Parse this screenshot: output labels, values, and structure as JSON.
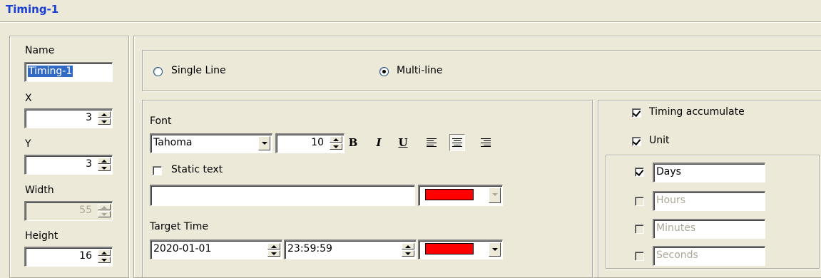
{
  "window": {
    "title": "Timing-1"
  },
  "left": {
    "name_label": "Name",
    "name_value": "Timing-1",
    "x_label": "X",
    "x_value": "3",
    "y_label": "Y",
    "y_value": "3",
    "width_label": "Width",
    "width_value": "55",
    "height_label": "Height",
    "height_value": "16"
  },
  "mode": {
    "single_line_label": "Single Line",
    "multi_line_label": "Multi-line",
    "selected": "multi-line"
  },
  "font": {
    "label": "Font",
    "family": "Tahoma",
    "size": "10",
    "bold_label": "B",
    "italic_label": "I",
    "underline_label": "U",
    "alignment": "center"
  },
  "static_text": {
    "label": "Static text",
    "checked": false,
    "value": "",
    "color": "#ff0000"
  },
  "target_time": {
    "label": "Target Time",
    "date": "2020-01-01",
    "time": "23:59:59",
    "color": "#ff0000"
  },
  "options": {
    "timing_accumulate_label": "Timing accumulate",
    "timing_accumulate_checked": true,
    "unit_label": "Unit",
    "unit_checked": true
  },
  "units": [
    {
      "label": "Days",
      "checked": true,
      "enabled": true
    },
    {
      "label": "Hours",
      "checked": false,
      "enabled": false
    },
    {
      "label": "Minutes",
      "checked": false,
      "enabled": false
    },
    {
      "label": "Seconds",
      "checked": false,
      "enabled": false
    }
  ]
}
